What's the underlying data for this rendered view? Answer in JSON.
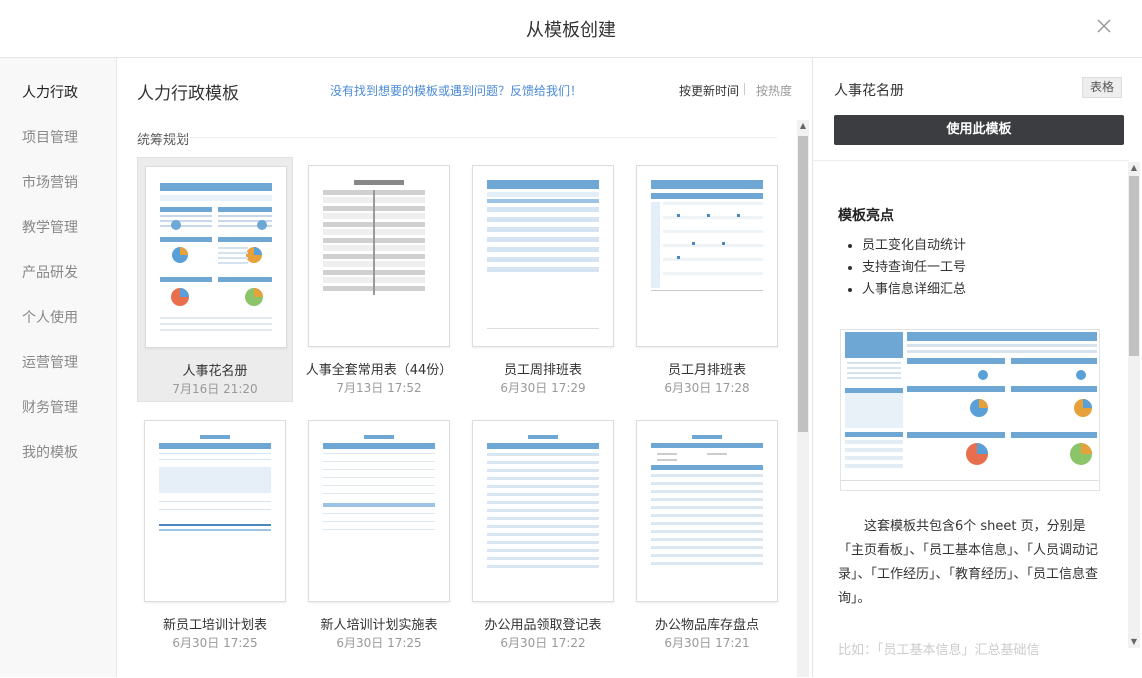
{
  "dialog": {
    "title": "从模板创建"
  },
  "sidebar": {
    "items": [
      {
        "label": "人力行政",
        "active": true
      },
      {
        "label": "项目管理"
      },
      {
        "label": "市场营销"
      },
      {
        "label": "教学管理"
      },
      {
        "label": "产品研发"
      },
      {
        "label": "个人使用"
      },
      {
        "label": "运营管理"
      },
      {
        "label": "财务管理"
      },
      {
        "label": "我的模板"
      }
    ]
  },
  "main": {
    "heading": "人力行政模板",
    "feedback": "没有找到想要的模板或遇到问题？反馈给我们！",
    "sort_latest": "按更新时间",
    "sort_hot": "按热度",
    "section": "统筹规划",
    "cards": [
      {
        "name": "人事花名册",
        "date": "7月16日 21:20"
      },
      {
        "name": "人事全套常用表（44份）",
        "date": "7月13日 17:52"
      },
      {
        "name": "员工周排班表",
        "date": "6月30日 17:29"
      },
      {
        "name": "员工月排班表",
        "date": "6月30日 17:28"
      },
      {
        "name": "新员工培训计划表",
        "date": "6月30日 17:25"
      },
      {
        "name": "新人培训计划实施表",
        "date": "6月30日 17:25"
      },
      {
        "name": "办公用品领取登记表",
        "date": "6月30日 17:22"
      },
      {
        "name": "办公物品库存盘点",
        "date": "6月30日 17:21"
      }
    ]
  },
  "detail": {
    "template_name": "人事花名册",
    "type_badge": "表格",
    "use_button": "使用此模板",
    "highlights_title": "模板亮点",
    "highlights": [
      "员工变化自动统计",
      "支持查询任一工号",
      "人事信息详细汇总"
    ],
    "description": "这套模板共包含6个 sheet 页，分别是「主页看板」、「员工基本信息」、「人员调动记录」、「工作经历」、「教育经历」、「员工信息查询」。",
    "description_more": "比如：「员工基本信息」汇总基础信"
  },
  "colors": {
    "accent_blue": "#4a8ad8",
    "button_dark": "#3b3d40",
    "sheet_blue": "#6ea6d4"
  }
}
